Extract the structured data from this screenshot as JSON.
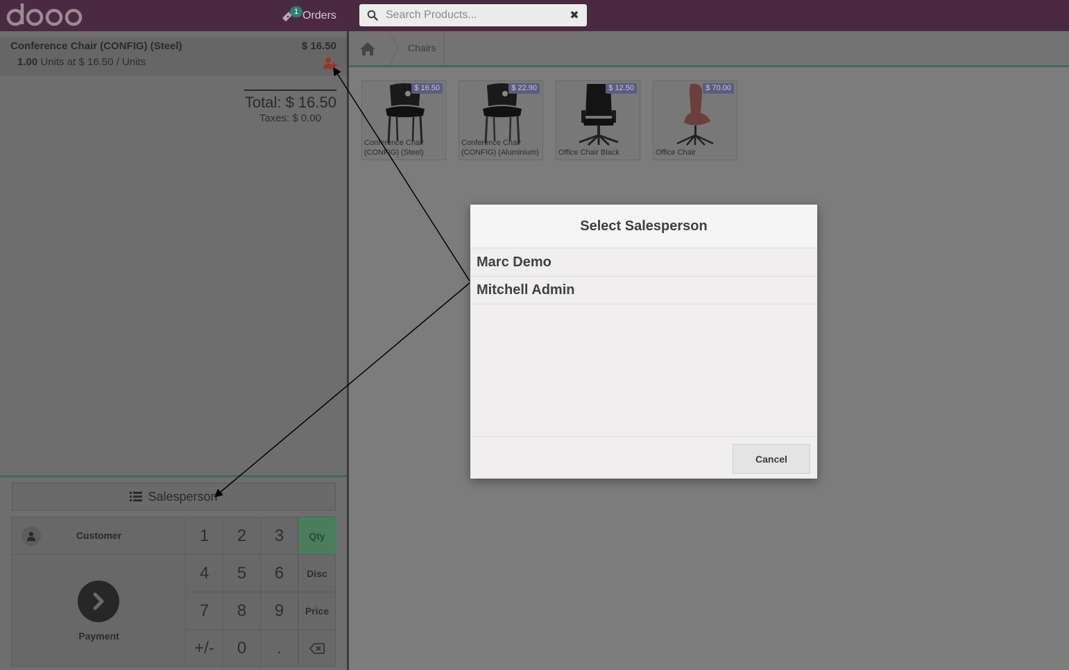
{
  "topbar": {
    "logo_text": "odoo",
    "orders_label": "Orders",
    "orders_count": "1",
    "search": {
      "placeholder": "Search Products...",
      "value": ""
    }
  },
  "order": {
    "line": {
      "product": "Conference Chair (CONFIG) (Steel)",
      "price": "$ 16.50",
      "qty": "1.00",
      "unit_info": "Units at $ 16.50 / Units"
    },
    "total": "Total: $ 16.50",
    "taxes": "Taxes: $ 0.00"
  },
  "controls": {
    "salesperson_label": "Salesperson",
    "customer_label": "Customer",
    "payment_label": "Payment",
    "numpad": {
      "k1": "1",
      "k2": "2",
      "k3": "3",
      "k4": "4",
      "k5": "5",
      "k6": "6",
      "k7": "7",
      "k8": "8",
      "k9": "9",
      "plusminus": "+/-",
      "k0": "0",
      "dot": "."
    },
    "modes": {
      "qty": "Qty",
      "disc": "Disc",
      "price": "Price"
    },
    "active_mode": "Qty"
  },
  "breadcrumb": {
    "category": "Chairs"
  },
  "products": [
    {
      "name_line1": "Conference Chair",
      "name_line2": "(CONFIG) (Steel)",
      "price": "$ 16.50",
      "image": "black-stacking-chair"
    },
    {
      "name_line1": "Conference Chair",
      "name_line2": "(CONFIG) (Aluminium)",
      "price": "$ 22.90",
      "image": "black-stacking-chair"
    },
    {
      "name_line1": "Office Chair Black",
      "name_line2": "",
      "price": "$ 12.50",
      "image": "black-office-chair"
    },
    {
      "name_line1": "Office Chair",
      "name_line2": "",
      "price": "$ 70.00",
      "image": "brown-shell-chair"
    }
  ],
  "modal": {
    "title": "Select Salesperson",
    "options": [
      "Marc Demo",
      "Mitchell Admin"
    ],
    "cancel_label": "Cancel"
  },
  "colors": {
    "topbar": "#4b2942",
    "accent_green": "#4a7d5e",
    "salesman_icon": "#a3311c",
    "price_tag": "#5c5b80"
  }
}
